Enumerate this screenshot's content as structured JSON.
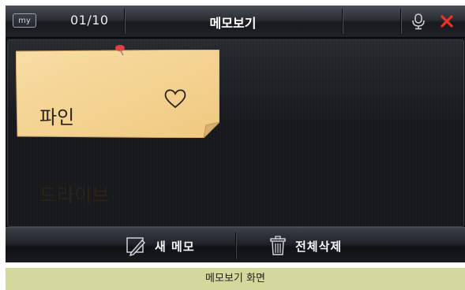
{
  "titlebar": {
    "my_label": "my",
    "counter": "01/10",
    "title": "메모보기",
    "mic_icon": "microphone-icon",
    "close_icon": "close-icon"
  },
  "note": {
    "line1": "파인",
    "line2": "드라이브",
    "decoration": "heart-icon",
    "pin_icon": "pushpin-icon",
    "color": "#f7d79a"
  },
  "bottombar": {
    "new_memo_label": "새 메모",
    "new_memo_icon": "pen-icon",
    "delete_all_label": "전체삭제",
    "delete_all_icon": "trash-icon"
  },
  "caption": "메모보기 화면",
  "colors": {
    "close": "#e8322a",
    "caption_bg": "#d3d99c"
  }
}
